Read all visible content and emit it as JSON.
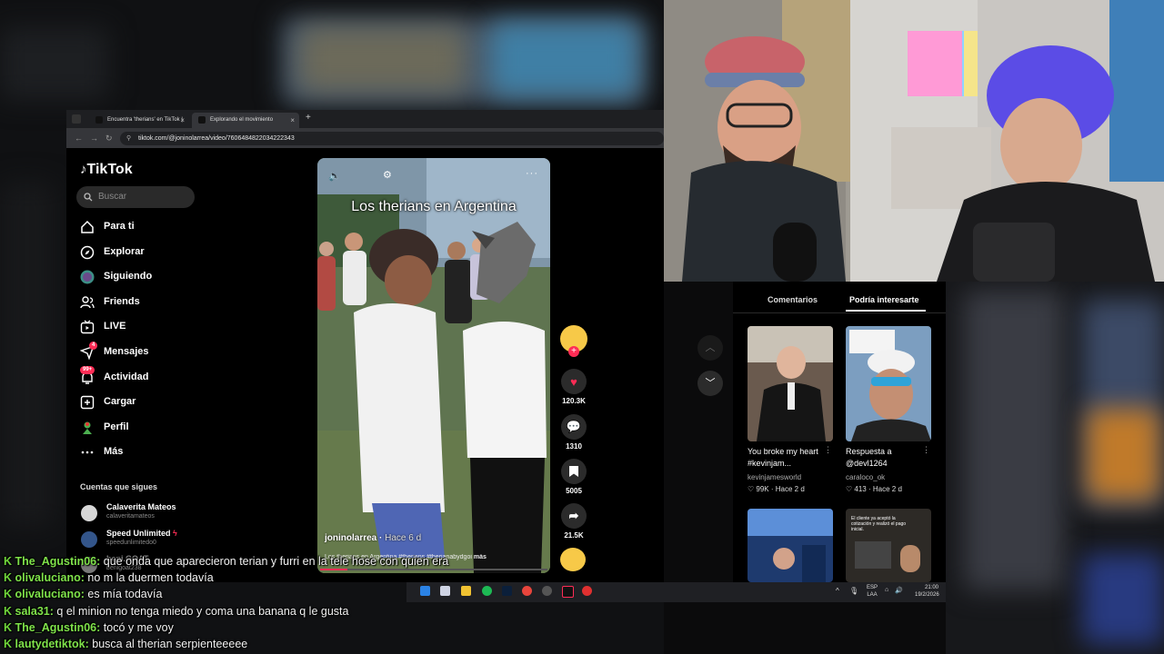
{
  "browser": {
    "tabs": [
      {
        "label": "Encuentra 'therians' en TikTok |"
      },
      {
        "label": "Explorando el movimiento"
      }
    ],
    "new_tab": "+",
    "url": "tiktok.com/@joninolarrea/video/7606484822034222343"
  },
  "tiktok": {
    "logo": "TikTok",
    "search_placeholder": "Buscar",
    "nav": [
      {
        "label": "Para ti",
        "icon": "home-icon"
      },
      {
        "label": "Explorar",
        "icon": "compass-icon"
      },
      {
        "label": "Siguiendo",
        "icon": "following-icon"
      },
      {
        "label": "Friends",
        "icon": "friends-icon"
      },
      {
        "label": "LIVE",
        "icon": "live-icon"
      },
      {
        "label": "Mensajes",
        "icon": "messages-icon",
        "badge": "4"
      },
      {
        "label": "Actividad",
        "icon": "activity-icon",
        "badge": "99+"
      },
      {
        "label": "Cargar",
        "icon": "upload-icon"
      },
      {
        "label": "Perfil",
        "icon": "profile-icon"
      },
      {
        "label": "Más",
        "icon": "more-icon"
      }
    ],
    "following_heading": "Cuentas que sigues",
    "following": [
      {
        "name": "Calaverita Mateos",
        "handle": "calaveritamateos"
      },
      {
        "name": "Speed Unlimited",
        "handle": "speedunlimitedo0"
      },
      {
        "name": "beni.GOAT",
        "handle": "benigoat238"
      }
    ]
  },
  "video": {
    "title": "Los therians en Argentina",
    "author": "joninolarrea",
    "time": "Hace 6 d",
    "caption": "Los therians en Argentina #therians #therianabydgoi",
    "more": "más",
    "likes": "120.3K",
    "comments": "1310",
    "saves": "5005",
    "shares": "21.5K"
  },
  "panel": {
    "tabs": [
      "Comentarios",
      "Podría interesarte"
    ],
    "cards": [
      {
        "title": "You broke my heart #kevinjam...",
        "author": "kevinjamesworld",
        "likes": "99K",
        "time": "Hace 2 d"
      },
      {
        "title": "Respuesta a @devl1264",
        "author": "caraloco_ok",
        "likes": "413",
        "time": "Hace 2 d"
      },
      {
        "title": "",
        "author": "",
        "likes": "",
        "time": ""
      },
      {
        "title": "El cliente ya aceptó la cotización y realizó el pago inicial.",
        "author": "",
        "likes": "",
        "time": ""
      }
    ]
  },
  "taskbar": {
    "lang1": "ESP",
    "lang2": "LAA",
    "time": "21:00",
    "date": "19/2/2026"
  },
  "chat": [
    {
      "user": "The_Agustin06:",
      "msg": "que onda que aparecieron terian y furri en la tele hose con quien era"
    },
    {
      "user": "olivaluciano:",
      "msg": "no m la duermen todavía"
    },
    {
      "user": "olivaluciano:",
      "msg": "es mía todavía"
    },
    {
      "user": "sala31:",
      "msg": "q el minion no tenga miedo y coma una banana q le gusta"
    },
    {
      "user": "The_Agustin06:",
      "msg": "tocó y me voy"
    },
    {
      "user": "lautydetiktok:",
      "msg": "busca al therian serpienteeeee"
    }
  ],
  "chat_badge": "K",
  "colors": {
    "tiktok_red": "#fe2c55",
    "chat_user": "#7fe24a",
    "panel_bg": "#000000"
  }
}
